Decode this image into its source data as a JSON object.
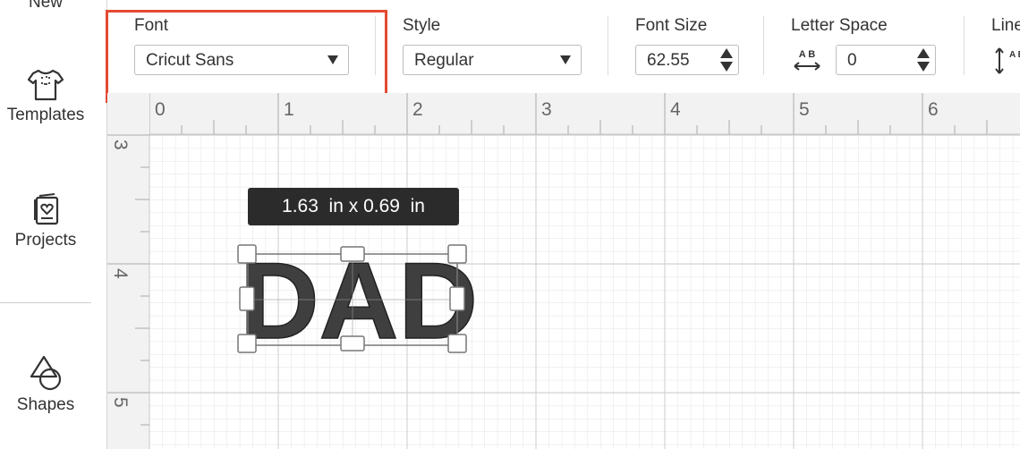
{
  "sidebar": {
    "items": [
      {
        "label": "New",
        "icon": "new-icon"
      },
      {
        "label": "Templates",
        "icon": "tshirt-icon"
      },
      {
        "label": "Projects",
        "icon": "projects-icon"
      },
      {
        "label": "Shapes",
        "icon": "shapes-icon"
      }
    ]
  },
  "toolbar": {
    "font": {
      "label": "Font",
      "value": "Cricut Sans"
    },
    "style": {
      "label": "Style",
      "value": "Regular"
    },
    "font_size": {
      "label": "Font Size",
      "value": "62.55"
    },
    "letter_space": {
      "label": "Letter Space",
      "value": "0",
      "icon_text": "A B"
    },
    "line_space": {
      "label": "Line",
      "icon_text": "A B"
    }
  },
  "rulers": {
    "horizontal": [
      "0",
      "1",
      "2",
      "3",
      "4",
      "5",
      "6"
    ],
    "vertical": [
      "3",
      "4",
      "5"
    ]
  },
  "canvas": {
    "text_object": "DAD",
    "dimension_tooltip": "1.63  in x 0.69  in"
  },
  "colors": {
    "highlight": "#e34a32",
    "text_fill": "#3f3f3f",
    "tooltip_bg": "#2b2b2b"
  }
}
